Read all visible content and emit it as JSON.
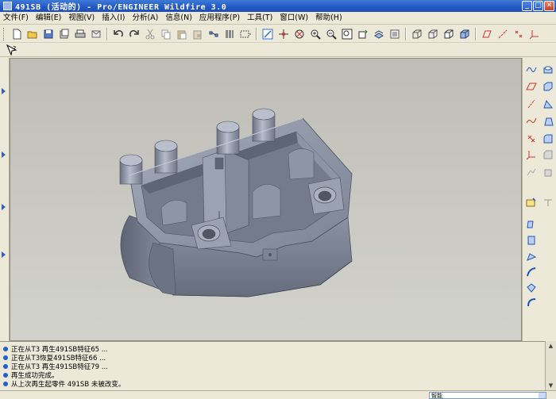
{
  "window": {
    "title": "491SB (活动的) - Pro/ENGINEER Wildfire 3.0",
    "minimize_glyph": "_",
    "maximize_glyph": "□",
    "close_glyph": "✕"
  },
  "menus": [
    {
      "label": "文件(F)"
    },
    {
      "label": "编辑(E)"
    },
    {
      "label": "视图(V)"
    },
    {
      "label": "插入(I)"
    },
    {
      "label": "分析(A)"
    },
    {
      "label": "信息(N)"
    },
    {
      "label": "应用程序(P)"
    },
    {
      "label": "工具(T)"
    },
    {
      "label": "窗口(W)"
    },
    {
      "label": "帮助(H)"
    }
  ],
  "toolbar_icons": [
    "new-file-icon",
    "open-file-icon",
    "save-icon",
    "save-copy-icon",
    "print-icon",
    "email-icon",
    "undo-icon",
    "redo-icon",
    "cut-icon",
    "copy-icon",
    "paste-icon",
    "paste-special-icon",
    "regenerate-icon",
    "model-tree-icon",
    "select-filter-icon",
    "repaint-icon",
    "spin-center-icon",
    "orient-icon",
    "zoom-in-icon",
    "zoom-out-icon",
    "refit-icon",
    "reorient-icon",
    "saved-views-icon",
    "layers-icon",
    "wireframe-icon",
    "hidden-line-icon",
    "no-hidden-icon",
    "shading-icon",
    "datum-planes-icon",
    "datum-axes-icon",
    "datum-points-icon",
    "coord-sys-icon"
  ],
  "context_help_icon": "context-help-icon",
  "model": {
    "name": "491SB",
    "colors": {
      "body": "#7e8698",
      "light": "#a7aebd",
      "dark": "#5b6272",
      "edge": "#4a5060"
    }
  },
  "messages": [
    "正在从T3 再生491SB特征65 ...",
    "正在从T3恢复491SB特征66 ...",
    "正在从T3 再生491SB特征79 ...",
    "再生成功完成。",
    "从上次再生起零件 491SB 未被改变。"
  ],
  "status": {
    "filter_value": "智能"
  },
  "colors": {
    "accent": "#1f5fd0",
    "titlebar": "#2458c4",
    "viewport_bg": "#c8c8c1"
  }
}
